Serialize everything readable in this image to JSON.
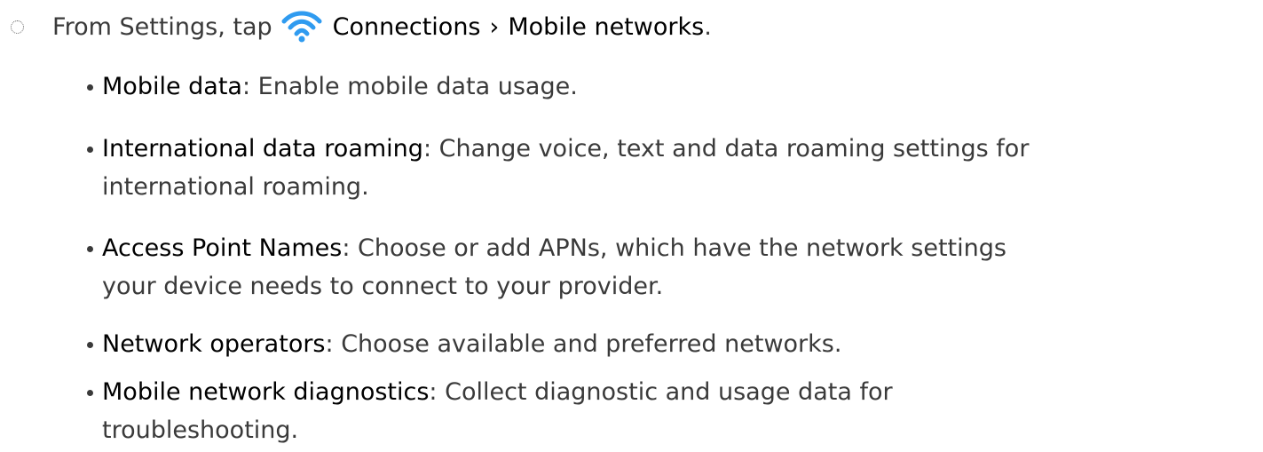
{
  "step": {
    "prefix": "From Settings, tap",
    "menu_connections": "Connections",
    "separator": "›",
    "menu_mobile_networks": "Mobile networks",
    "end": ".",
    "icon": "wifi-icon",
    "icon_color": "#2f9bf0"
  },
  "items": [
    {
      "term": "Mobile data",
      "desc": ": Enable mobile data usage."
    },
    {
      "term": "International data roaming",
      "desc_line1": ": Change voice, text and data roaming settings for",
      "desc_line2": "international roaming."
    },
    {
      "term": "Access Point Names",
      "desc_line1": ": Choose or add APNs, which have the network settings",
      "desc_line2": "your device needs to connect to your provider."
    },
    {
      "term": "Network operators",
      "desc": ": Choose available and preferred networks."
    },
    {
      "term": "Mobile network diagnostics",
      "desc_line1": ": Collect diagnostic and usage data for",
      "desc_line2": "troubleshooting."
    }
  ]
}
